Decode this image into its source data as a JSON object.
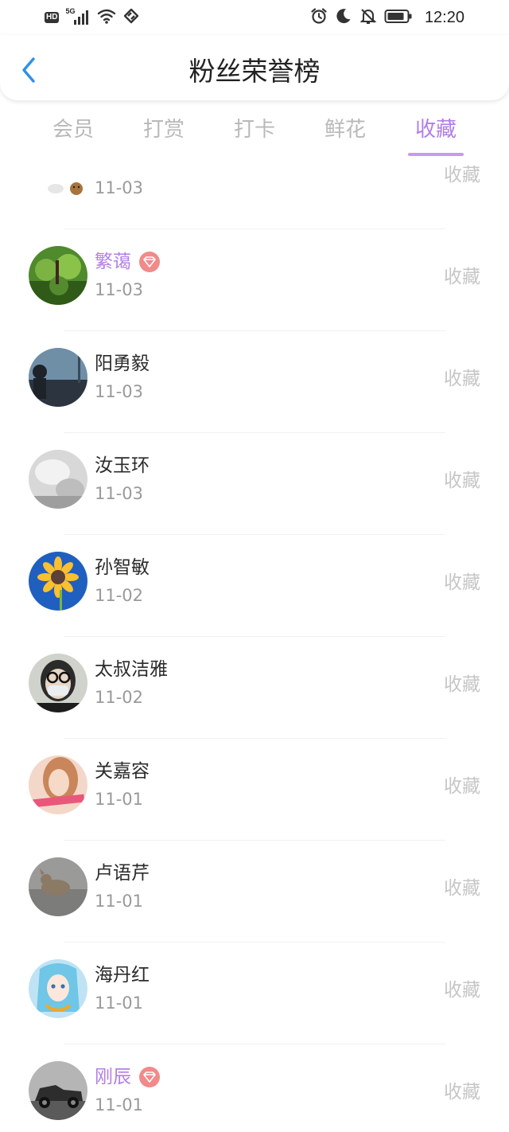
{
  "status_bar": {
    "network_badge": "HD",
    "network_type": "5G",
    "time": "12:20",
    "icons": [
      "signal-icon",
      "wifi-icon",
      "link-icon",
      "alarm-icon",
      "moon-icon",
      "bell-mute-icon",
      "battery-icon"
    ]
  },
  "header": {
    "title": "粉丝荣誉榜",
    "back_icon": "chevron-left-icon"
  },
  "tabs": [
    {
      "label": "会员",
      "active": false
    },
    {
      "label": "打赏",
      "active": false
    },
    {
      "label": "打卡",
      "active": false
    },
    {
      "label": "鲜花",
      "active": false
    },
    {
      "label": "收藏",
      "active": true
    }
  ],
  "list": [
    {
      "name": "",
      "date": "11-03",
      "action": "收藏",
      "vip": false,
      "partial": true
    },
    {
      "name": "繁蔼",
      "date": "11-03",
      "action": "收藏",
      "vip": true
    },
    {
      "name": "阳勇毅",
      "date": "11-03",
      "action": "收藏",
      "vip": false
    },
    {
      "name": "汝玉环",
      "date": "11-03",
      "action": "收藏",
      "vip": false
    },
    {
      "name": "孙智敏",
      "date": "11-02",
      "action": "收藏",
      "vip": false
    },
    {
      "name": "太叔洁雅",
      "date": "11-02",
      "action": "收藏",
      "vip": false
    },
    {
      "name": "关嘉容",
      "date": "11-01",
      "action": "收藏",
      "vip": false
    },
    {
      "name": "卢语芹",
      "date": "11-01",
      "action": "收藏",
      "vip": false
    },
    {
      "name": "海丹红",
      "date": "11-01",
      "action": "收藏",
      "vip": false
    },
    {
      "name": "刚辰",
      "date": "11-01",
      "action": "收藏",
      "vip": true
    }
  ],
  "colors": {
    "accent": "#b07ee6",
    "tab_inactive": "#b9b9b9",
    "date_text": "#9a9a9a",
    "action_text": "#c6c6c6",
    "back_arrow": "#2f8fe8",
    "vip_badge": "#f18a8a"
  }
}
